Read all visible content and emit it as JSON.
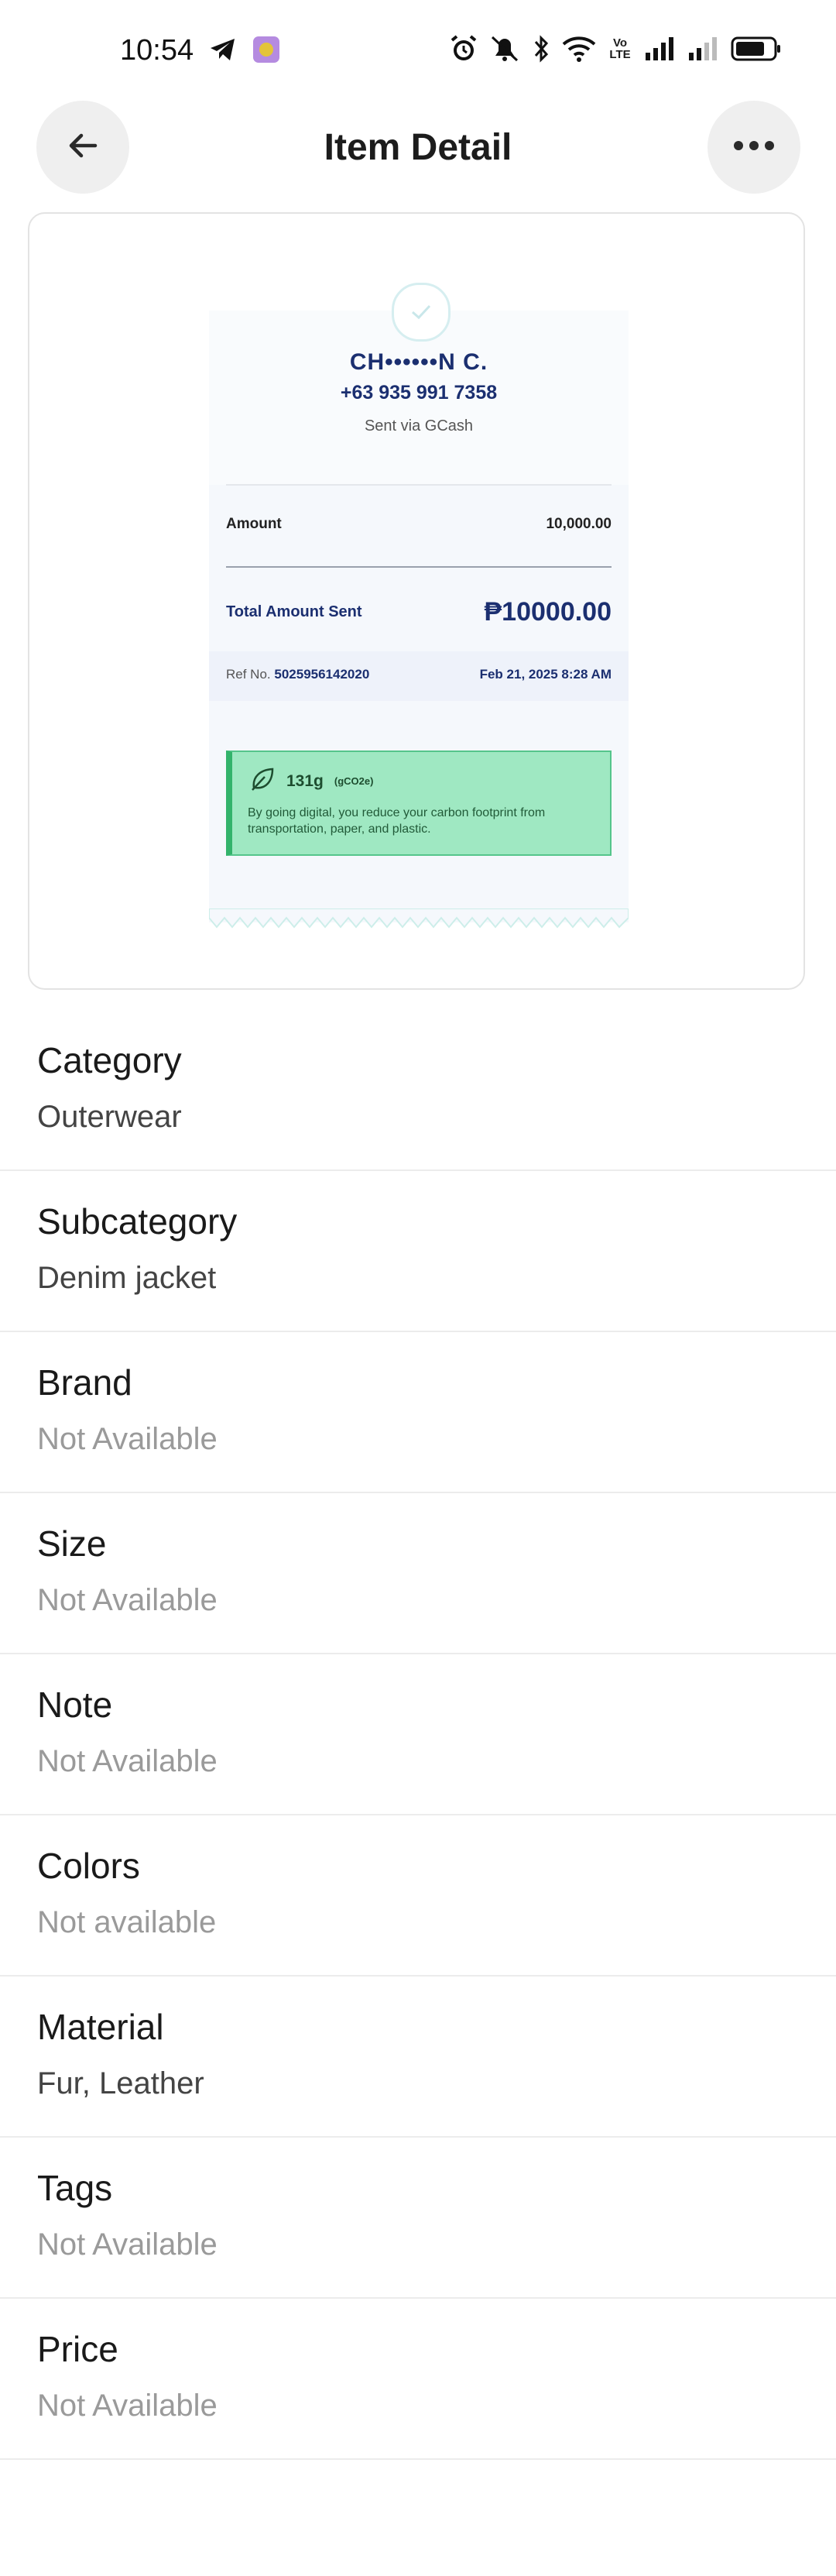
{
  "status_bar": {
    "time": "10:54",
    "network_label": "Vo LTE"
  },
  "header": {
    "title": "Item Detail"
  },
  "receipt": {
    "recipient_name": "CH••••••N C.",
    "recipient_phone": "+63 935 991 7358",
    "sent_via": "Sent via GCash",
    "amount_label": "Amount",
    "amount_value": "10,000.00",
    "total_label": "Total Amount Sent",
    "total_value": "₱10000.00",
    "ref_label": "Ref No.",
    "ref_number": "5025956142020",
    "date": "Feb 21, 2025 8:28 AM",
    "eco_value": "131g",
    "eco_unit": "(gCO2e)",
    "eco_text": "By going digital, you reduce your carbon footprint from transportation, paper, and plastic.",
    "colors": {
      "brand_navy": "#1b2f70",
      "eco_green": "#9fe8c2"
    }
  },
  "details": [
    {
      "label": "Category",
      "value": "Outerwear",
      "muted": false
    },
    {
      "label": "Subcategory",
      "value": "Denim jacket",
      "muted": false
    },
    {
      "label": "Brand",
      "value": "Not Available",
      "muted": true
    },
    {
      "label": "Size",
      "value": "Not Available",
      "muted": true
    },
    {
      "label": "Note",
      "value": "Not Available",
      "muted": true
    },
    {
      "label": "Colors",
      "value": "Not available",
      "muted": true
    },
    {
      "label": "Material",
      "value": "Fur, Leather",
      "muted": false
    },
    {
      "label": "Tags",
      "value": "Not Available",
      "muted": true
    },
    {
      "label": "Price",
      "value": "Not Available",
      "muted": true
    }
  ]
}
